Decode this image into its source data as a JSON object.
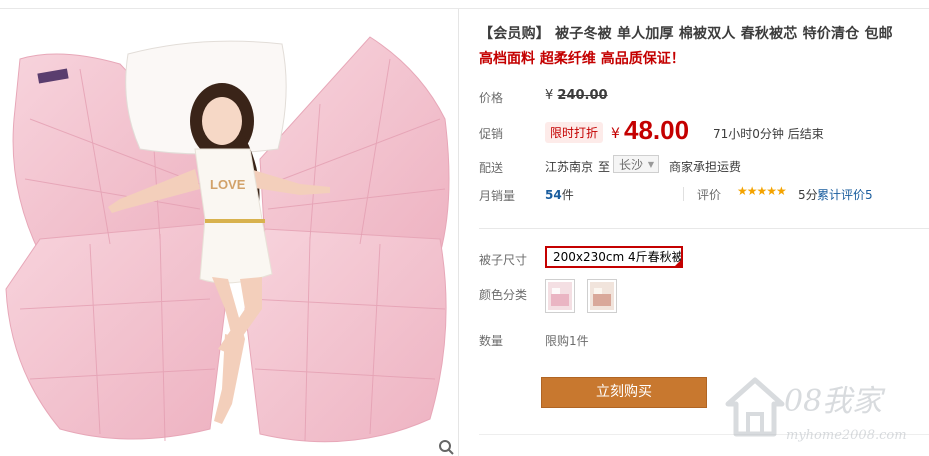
{
  "product": {
    "title": "【会员购】 被子冬被 单人加厚 棉被双人 春秋被芯 特价清仓 包邮",
    "subtitle": "高档面料 超柔纤维 高品质保证！"
  },
  "price": {
    "label": "价格",
    "currency": "¥",
    "original": "240.00"
  },
  "promo": {
    "label": "促销",
    "tag": "限时打折",
    "currency": "¥",
    "price": "48.00",
    "countdown": "71小时0分钟 后结束"
  },
  "shipping": {
    "label": "配送",
    "from": "江苏南京",
    "to_word": "至",
    "destination": "长沙",
    "fee_text": "商家承担运费"
  },
  "sales": {
    "label": "月销量",
    "count": "54",
    "unit": "件"
  },
  "rating": {
    "label": "评价",
    "stars": "★★★★★",
    "score_text": "5分",
    "link_text": "累计评价5"
  },
  "options": {
    "size_label": "被子尺寸",
    "size_value": "200x230cm 4斤春秋被",
    "color_label": "颜色分类",
    "quantity_label": "数量",
    "quantity_text": "限购1件"
  },
  "actions": {
    "buy_label": "立刻购买"
  },
  "watermark": {
    "brand": "08我家",
    "url": "myhome2008.com"
  },
  "colors": {
    "accent_red": "#c40000",
    "buy_button": "#c8782f",
    "link_blue": "#1a5d9e",
    "quilt_pink": "#f2c3cf"
  }
}
